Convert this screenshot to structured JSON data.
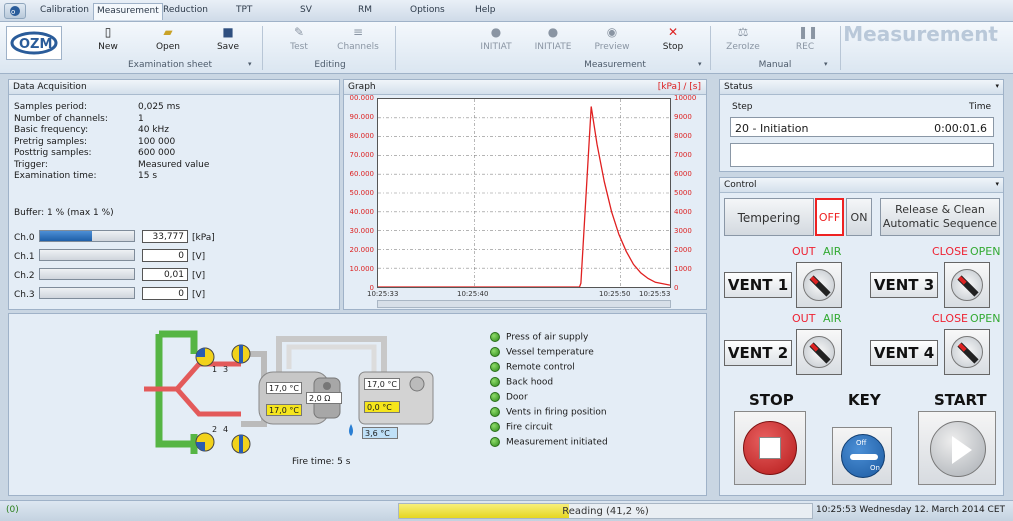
{
  "tabs": [
    "Calibration",
    "Measurement",
    "Reduction",
    "TPT",
    "SV",
    "RM",
    "Options",
    "Help"
  ],
  "ribbon": {
    "logo_text": "OZM",
    "buttons": {
      "new": "New",
      "open": "Open",
      "save": "Save",
      "test": "Test",
      "channels": "Channels",
      "initiat": "INITIAT",
      "initiate": "INITIATE",
      "preview": "Preview",
      "stop": "Stop",
      "zeroize": "ZeroIze",
      "rec": "REC"
    },
    "groups": {
      "exam": "Examination sheet",
      "editing": "Editing",
      "measurement": "Measurement",
      "manual": "Manual"
    },
    "title": "Measurement"
  },
  "daq": {
    "header": "Data Acquisition",
    "rows": [
      {
        "k": "Samples period:",
        "v": "0,025 ms"
      },
      {
        "k": "Number of channels:",
        "v": "1"
      },
      {
        "k": "Basic frequency:",
        "v": "40 kHz"
      },
      {
        "k": "Pretrig samples:",
        "v": "100 000"
      },
      {
        "k": "Posttrig samples:",
        "v": "600 000"
      },
      {
        "k": "Trigger:",
        "v": "Measured value"
      },
      {
        "k": "Examination time:",
        "v": "15 s"
      }
    ],
    "buffer": "Buffer: 1 % (max 1 %)",
    "channels": [
      {
        "name": "Ch.0",
        "value": "33,777",
        "unit": "[kPa]",
        "level": 0.55
      },
      {
        "name": "Ch.1",
        "value": "0",
        "unit": "[V]",
        "level": 0
      },
      {
        "name": "Ch.2",
        "value": "0,01",
        "unit": "[V]",
        "level": 0
      },
      {
        "name": "Ch.3",
        "value": "0",
        "unit": "[V]",
        "level": 0
      }
    ]
  },
  "graph": {
    "header": "Graph",
    "units": "[kPa] / [s]",
    "yticks_left": [
      "00.000",
      "90.000",
      "80.000",
      "70.000",
      "60.000",
      "50.000",
      "40.000",
      "30.000",
      "20.000",
      "10.000",
      "0"
    ],
    "yticks_right": [
      "10000",
      "9000",
      "8000",
      "7000",
      "6000",
      "5000",
      "4000",
      "3000",
      "2000",
      "1000",
      "0"
    ],
    "xticks": [
      "10:25:33",
      "10:25:40",
      "10:25:50",
      "10:25:53"
    ]
  },
  "chart_data": {
    "type": "line",
    "x_unit": "s",
    "y_unit": "kPa",
    "xlim": [
      0,
      20
    ],
    "ylim": [
      0,
      10000
    ],
    "series": [
      {
        "x": [
          0,
          13.8,
          13.9,
          14.6,
          15.0,
          15.5,
          16.0,
          16.5,
          17.0,
          17.5,
          18.0,
          18.5,
          19.0,
          20.0
        ],
        "y": [
          0,
          0,
          200,
          9600,
          7600,
          5600,
          4000,
          2800,
          1900,
          1200,
          750,
          450,
          250,
          100
        ]
      }
    ]
  },
  "status": {
    "header": "Status",
    "col_step": "Step",
    "col_time": "Time",
    "step": "20 - Initiation",
    "time": "0:00:01.6"
  },
  "control": {
    "header": "Control",
    "tempering": "Tempering",
    "off": "OFF",
    "on": "ON",
    "release": "Release & Clean\nAutomatic Sequence",
    "vents": [
      {
        "label": "VENT 1",
        "left": "OUT",
        "right": "AIR"
      },
      {
        "label": "VENT 3",
        "left": "CLOSE",
        "right": "OPEN"
      },
      {
        "label": "VENT 2",
        "left": "OUT",
        "right": "AIR"
      },
      {
        "label": "VENT 4",
        "left": "CLOSE",
        "right": "OPEN"
      }
    ],
    "stop": "STOP",
    "key": "KEY",
    "start": "START",
    "key_off": "Off",
    "key_on": "On"
  },
  "schematic": {
    "port1": "1",
    "port3": "3",
    "port2": "2",
    "port4": "4",
    "temp1": "17,0 °C",
    "temp2": "17,0 °C",
    "temp3": "17,0 °C",
    "temp4": "0,0 °C",
    "temp5": "3,6 °C",
    "resistance": "2,0 Ω",
    "fire_time": "Fire time: 5 s"
  },
  "indicators": [
    "Press of air supply",
    "Vessel temperature",
    "Remote control",
    "Back hood",
    "Door",
    "Vents in firing position",
    "Fire circuit",
    "Measurement initiated"
  ],
  "statusbar": {
    "left": "(0)",
    "reading": "Reading (41,2 %)",
    "progress": 0.412,
    "datetime": "10:25:53 Wednesday 12. March 2014 CET"
  }
}
